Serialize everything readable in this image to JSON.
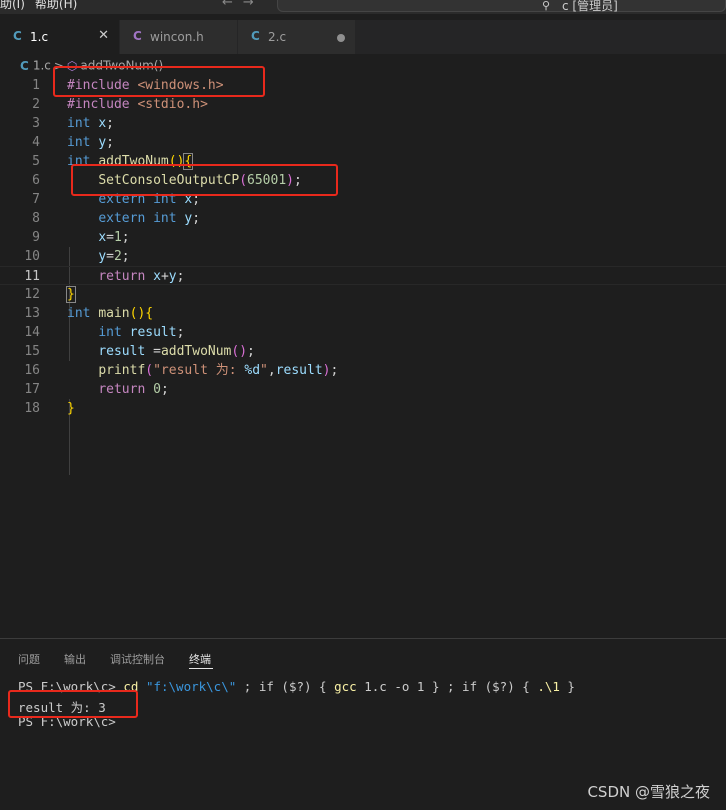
{
  "menu": {
    "item1": "助(I)",
    "item2": "帮助(H)"
  },
  "nav": {
    "back": "←",
    "forward": "→"
  },
  "command_center": {
    "text": "c [管理员]"
  },
  "tabs": [
    {
      "icon": "C",
      "label": "1.c",
      "active": true,
      "close": "✕"
    },
    {
      "icon": "C",
      "label": "wincon.h",
      "active": false
    },
    {
      "icon": "C",
      "label": "2.c",
      "active": false,
      "dirty": true
    }
  ],
  "colors": {
    "c_icon": "#519aba",
    "h_icon": "#a074c4",
    "highlight_box": "#e8291c"
  },
  "breadcrumb": {
    "file": "1.c",
    "separator": ">",
    "symbol": "addTwoNum()"
  },
  "editor": {
    "line_numbers": [
      "1",
      "2",
      "3",
      "4",
      "5",
      "6",
      "7",
      "8",
      "9",
      "10",
      "11",
      "12",
      "13",
      "14",
      "15",
      "16",
      "17",
      "18"
    ],
    "current_line": 11
  },
  "panel": {
    "tabs": [
      "问题",
      "输出",
      "调试控制台",
      "终端"
    ],
    "active_tab": "终端",
    "terminal": {
      "prompt": "PS F:\\work\\c> ",
      "cmd_cd": "cd",
      "cmd_path": "\"f:\\work\\c\\\"",
      "cmd_mid1": " ; if ($?) { ",
      "cmd_gcc": "gcc",
      "cmd_args": " 1.c -o 1 } ; if ($?) { ",
      "cmd_run": ".\\1",
      "cmd_end": " }",
      "output": "result 为: 3",
      "prompt2": "PS F:\\work\\c>"
    }
  },
  "watermark": "CSDN @雪狼之夜"
}
